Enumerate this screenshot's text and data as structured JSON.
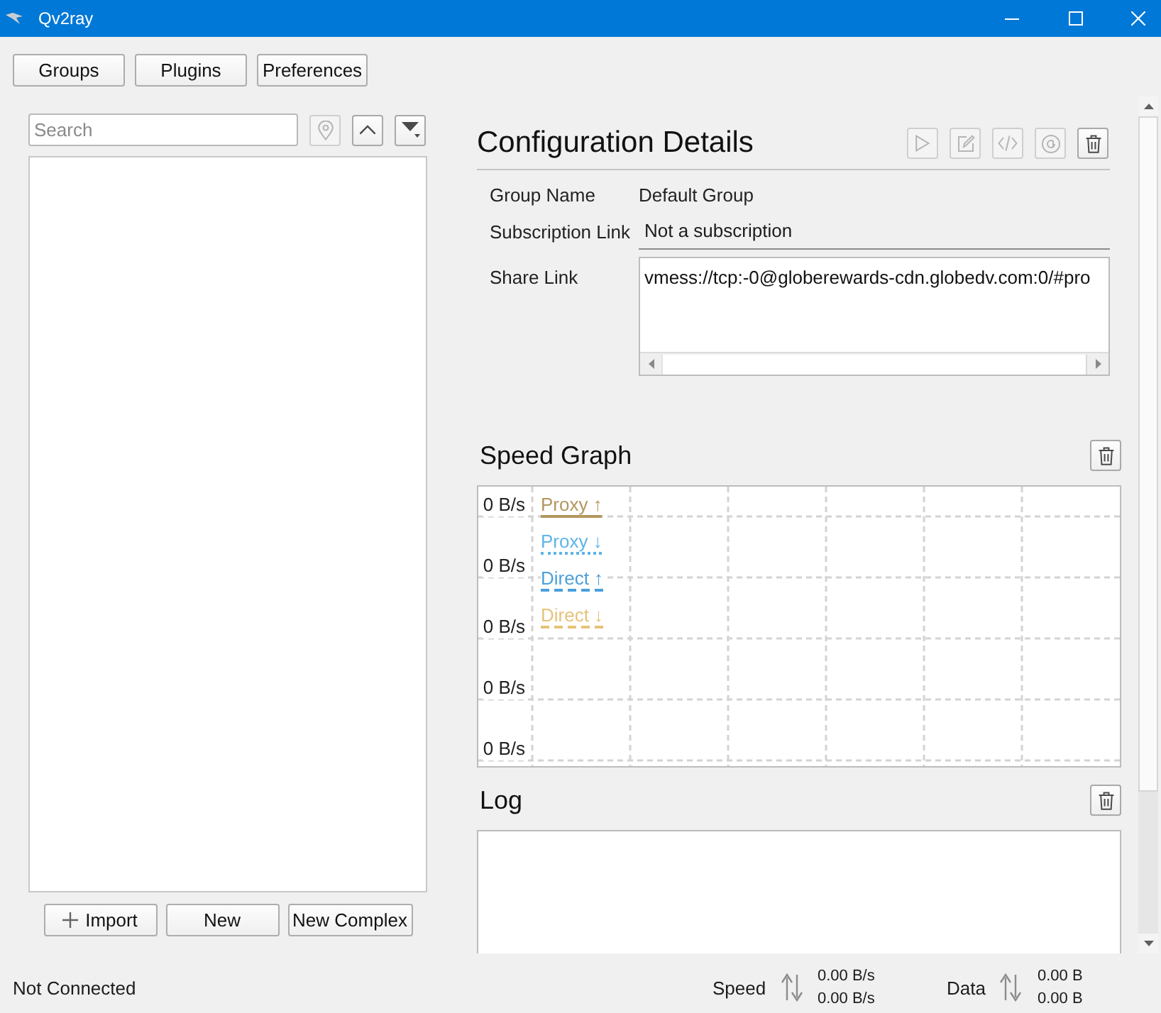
{
  "window": {
    "title": "Qv2ray"
  },
  "toolbar": {
    "buttons": [
      {
        "label": "Groups"
      },
      {
        "label": "Plugins"
      },
      {
        "label": "Preferences"
      }
    ]
  },
  "connections": {
    "search": {
      "placeholder": "Search"
    },
    "tools": [
      {
        "kind": "locate",
        "disabled": true
      },
      {
        "kind": "collapse",
        "disabled": false
      },
      {
        "kind": "sort",
        "disabled": false
      }
    ],
    "buttons": [
      {
        "kind": "import",
        "label": "Import"
      },
      {
        "kind": "plain",
        "label": "New"
      },
      {
        "kind": "plain",
        "label": "New Complex"
      }
    ]
  },
  "details": {
    "title": "Configuration Details",
    "actions": [
      {
        "kind": "connect",
        "disabled": true
      },
      {
        "kind": "edit",
        "disabled": true
      },
      {
        "kind": "edit_json",
        "disabled": true
      },
      {
        "kind": "ping",
        "disabled": true
      },
      {
        "kind": "delete",
        "disabled": false
      }
    ],
    "fields": [
      {
        "kind": "text",
        "label": "Group Name",
        "value": "Default Group"
      },
      {
        "kind": "line",
        "label": "Subscription Link",
        "value": "Not a subscription"
      },
      {
        "kind": "area",
        "label": "Share Link",
        "value": "vmess://tcp:-0@globerewards-cdn.globedv.com:0/#pro"
      }
    ]
  },
  "speed_graph": {
    "title": "Speed Graph",
    "axis_labels": [
      "0 B/s",
      "0 B/s",
      "0 B/s",
      "0 B/s",
      "0 B/s"
    ],
    "legend": [
      {
        "label": "Proxy ↑",
        "kind": "solid",
        "color": "#b3965f"
      },
      {
        "label": "Proxy ↓",
        "kind": "dotted",
        "color": "#5db5e6"
      },
      {
        "label": "Direct ↑",
        "kind": "dashed",
        "color": "#4a9fdc"
      },
      {
        "label": "Direct ↓",
        "kind": "dashed",
        "color": "#e6c27a"
      }
    ]
  },
  "log": {
    "title": "Log"
  },
  "status_bar": {
    "connection": "Not Connected",
    "speed": {
      "label": "Speed",
      "values": [
        "0.00 B/s",
        "0.00 B/s"
      ]
    },
    "data": {
      "label": "Data",
      "values": [
        "0.00 B",
        "0.00 B"
      ]
    }
  }
}
